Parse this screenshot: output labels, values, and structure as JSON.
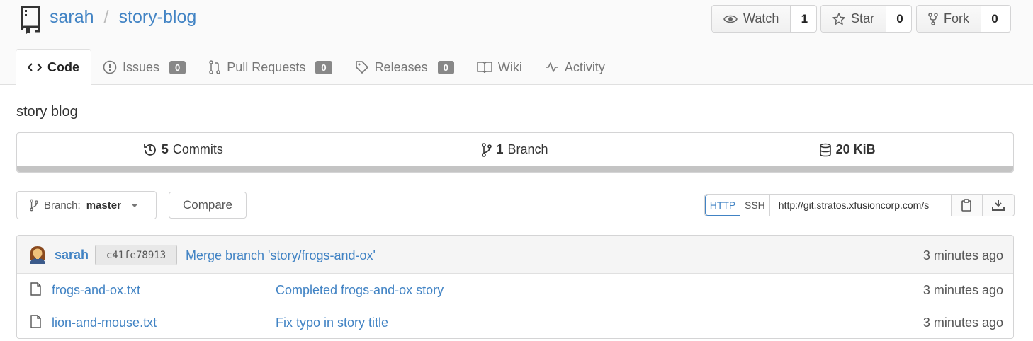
{
  "repo": {
    "owner": "sarah",
    "separator": "/",
    "name": "story-blog",
    "description": "story blog"
  },
  "actions": {
    "watch_label": "Watch",
    "watch_count": "1",
    "star_label": "Star",
    "star_count": "0",
    "fork_label": "Fork",
    "fork_count": "0"
  },
  "tabs": [
    {
      "label": "Code",
      "active": true
    },
    {
      "label": "Issues",
      "badge": "0"
    },
    {
      "label": "Pull Requests",
      "badge": "0"
    },
    {
      "label": "Releases",
      "badge": "0"
    },
    {
      "label": "Wiki"
    },
    {
      "label": "Activity"
    }
  ],
  "stats": {
    "commits_count": "5",
    "commits_label": "Commits",
    "branch_count": "1",
    "branch_label": "Branch",
    "size": "20 KiB"
  },
  "branch": {
    "prefix": "Branch:",
    "name": "master",
    "compare_label": "Compare"
  },
  "clone": {
    "http_label": "HTTP",
    "ssh_label": "SSH",
    "url": "http://git.stratos.xfusioncorp.com/s"
  },
  "latest_commit": {
    "author": "sarah",
    "sha": "c41fe78913",
    "message": "Merge branch 'story/frogs-and-ox'",
    "time": "3 minutes ago"
  },
  "files": [
    {
      "name": "frogs-and-ox.txt",
      "message": "Completed frogs-and-ox story",
      "time": "3 minutes ago"
    },
    {
      "name": "lion-and-mouse.txt",
      "message": "Fix typo in story title",
      "time": "3 minutes ago"
    }
  ],
  "colors": {
    "link": "#4183c4",
    "badge": "#888888",
    "header_bg": "#fafafa"
  }
}
